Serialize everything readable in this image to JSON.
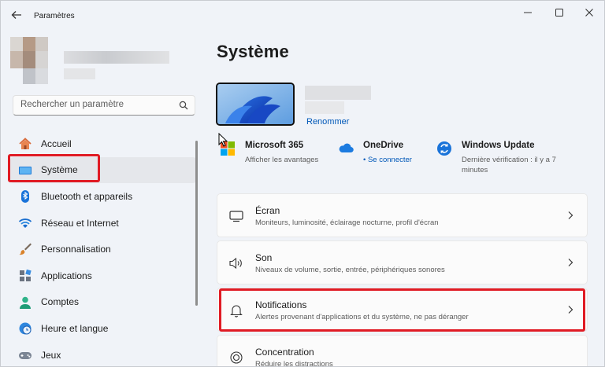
{
  "window": {
    "title": "Paramètres"
  },
  "search": {
    "placeholder": "Rechercher un paramètre"
  },
  "sidebar": {
    "items": [
      {
        "label": "Accueil",
        "icon": "home-icon"
      },
      {
        "label": "Système",
        "icon": "system-display-icon",
        "active": true
      },
      {
        "label": "Bluetooth et appareils",
        "icon": "bluetooth-icon"
      },
      {
        "label": "Réseau et Internet",
        "icon": "wifi-icon"
      },
      {
        "label": "Personnalisation",
        "icon": "brush-icon"
      },
      {
        "label": "Applications",
        "icon": "apps-icon"
      },
      {
        "label": "Comptes",
        "icon": "account-icon"
      },
      {
        "label": "Heure et langue",
        "icon": "clock-globe-icon"
      },
      {
        "label": "Jeux",
        "icon": "gamepad-icon"
      }
    ]
  },
  "main": {
    "title": "Système",
    "device": {
      "rename_label": "Renommer"
    },
    "quick": [
      {
        "title": "Microsoft 365",
        "subtitle": "Afficher les avantages",
        "icon": "microsoft-365-icon"
      },
      {
        "title": "OneDrive",
        "subtitle": "• Se connecter",
        "icon": "onedrive-icon"
      },
      {
        "title": "Windows Update",
        "subtitle": "Dernière vérification : il y a 7 minutes",
        "icon": "windows-update-icon"
      }
    ],
    "cards": [
      {
        "title": "Écran",
        "subtitle": "Moniteurs, luminosité, éclairage nocturne, profil d'écran",
        "icon": "monitor-icon"
      },
      {
        "title": "Son",
        "subtitle": "Niveaux de volume, sortie, entrée, périphériques sonores",
        "icon": "speaker-icon"
      },
      {
        "title": "Notifications",
        "subtitle": "Alertes provenant d'applications et du système, ne pas déranger",
        "icon": "bell-icon"
      },
      {
        "title": "Concentration",
        "subtitle": "Réduire les distractions",
        "icon": "focus-icon"
      }
    ]
  },
  "colors": {
    "highlight": "#e01b24",
    "accent": "#0058b8",
    "active_bg": "#e5e7eb"
  }
}
